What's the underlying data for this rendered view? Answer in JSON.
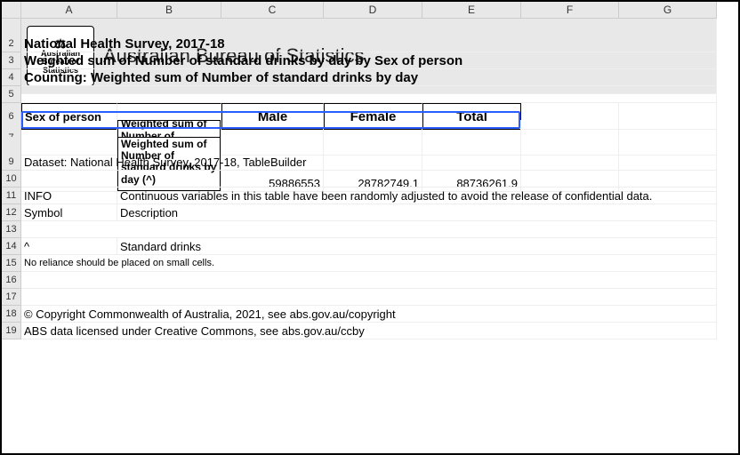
{
  "columns": [
    "",
    "A",
    "B",
    "C",
    "D",
    "E",
    "F",
    "G"
  ],
  "logo": {
    "line1": "Australian",
    "line2": "Bureau of",
    "line3": "Statistics"
  },
  "org_name": "Australian Bureau of Statistics",
  "r2": "National Health Survey, 2017-18",
  "r3": "Weighted sum of Number of standard drinks by day by Sex of person",
  "r4": "Counting: Weighted sum of Number of standard drinks by day",
  "r6": {
    "label": "Sex of person",
    "c": "Male",
    "d": "Female",
    "e": "Total"
  },
  "r7_box": "Weighted sum of Number of standard drinks",
  "r8_box": "Weighted sum of Number of standard drinks by day (^)",
  "r8": {
    "c": "59886553",
    "d": "28782749.1",
    "e": "88736261.9"
  },
  "r9": "Dataset: National Health Survey, 2017-18, TableBuilder",
  "r11": {
    "a": "INFO",
    "b": "Continuous variables in this table have been randomly adjusted to avoid the release of confidential data."
  },
  "r12": {
    "a": "Symbol",
    "b": "Description"
  },
  "r14": {
    "a": "^",
    "b": "Standard drinks"
  },
  "r15": "No reliance should be placed on small cells.",
  "r18": "© Copyright Commonwealth of Australia, 2021, see abs.gov.au/copyright",
  "r19": "ABS data licensed under Creative Commons, see abs.gov.au/ccby",
  "chart_data": {
    "type": "table",
    "title": "Weighted sum of Number of standard drinks by day by Sex of person",
    "dataset": "National Health Survey, 2017-18",
    "columns": [
      "Male",
      "Female",
      "Total"
    ],
    "rows": [
      {
        "label": "Weighted sum of Number of standard drinks by day (^)",
        "values": [
          59886553,
          28782749.1,
          88736261.9
        ]
      }
    ],
    "unit": "Standard drinks"
  }
}
